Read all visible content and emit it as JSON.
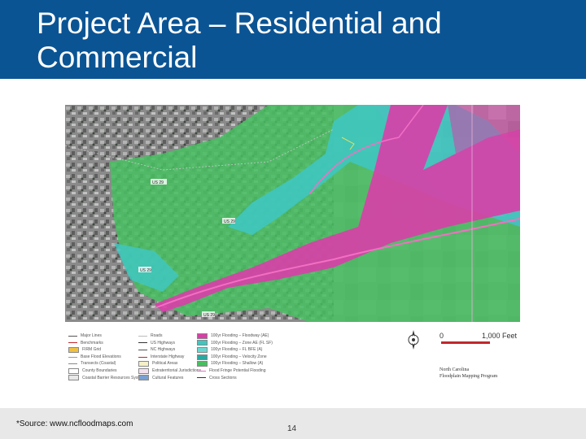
{
  "slide": {
    "title": "Project Area – Residential and Commercial",
    "source": "*Source: www.ncfloodmaps.com",
    "page_number": "14"
  },
  "map": {
    "scale_start": "0",
    "scale_end": "1,000 Feet",
    "program_line1": "North Carolina",
    "program_line2": "Floodplain Mapping Program",
    "street_labels": [
      "US 29",
      "US 29",
      "US 29",
      "US 29"
    ]
  },
  "legend": {
    "col1": [
      "Major Lines",
      "Benchmarks",
      "FIRM Grid",
      "Base Flood Elevations",
      "Transects (Coastal)",
      "County Boundaries",
      "Coastal Barrier Resources System"
    ],
    "col2": [
      "Roads",
      "US Highways",
      "NC Highways",
      "Interstate Highway",
      "Political Areas",
      "Extraterritorial Jurisdictions",
      "Cultural Features"
    ],
    "col3": [
      "100yr Flooding – Floodway (AE)",
      "100yr Flooding – Zone AE (FL SF)",
      "100yr Flooding – FL BFE (A)",
      "100yr Flooding – Velocity Zone",
      "100yr Flooding – Shallow (A)",
      "Flood Fringe Potential Flooding",
      "Cross Sections"
    ]
  },
  "colors": {
    "header": "#0b5494",
    "floodway": "#d93ea8",
    "zone_ae": "#3fc7c0",
    "zone_x": "#47bf60",
    "footer": "#e8e8e8"
  }
}
